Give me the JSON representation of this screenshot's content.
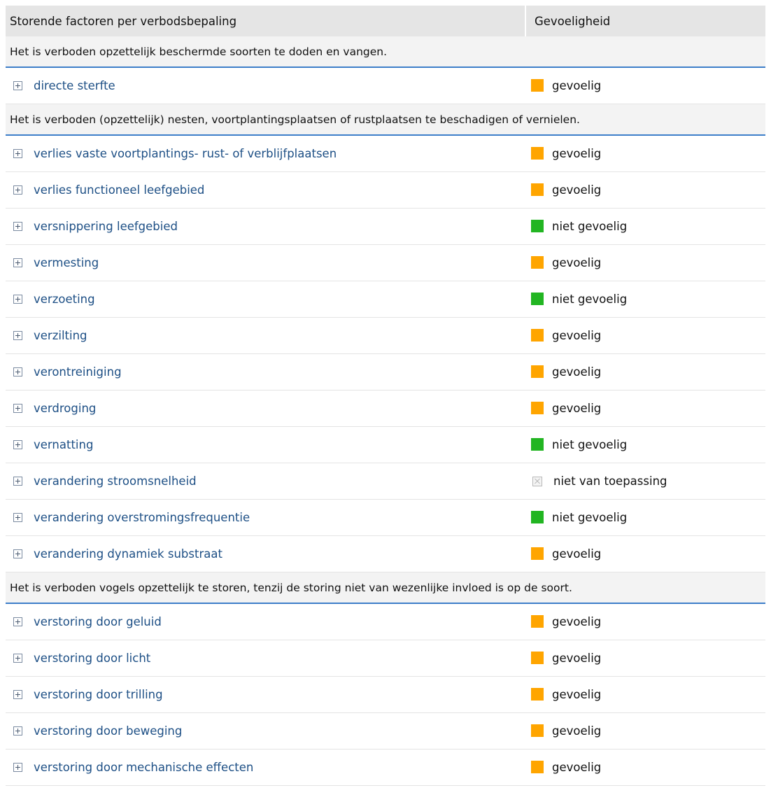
{
  "header": {
    "col_factor": "Storende factoren per verbodsbepaling",
    "col_sensitivity": "Gevoeligheid"
  },
  "legend_colors": {
    "gevoelig": "#ffa500",
    "niet gevoelig": "#22b522",
    "niet van toepassing": "#f4f4f4"
  },
  "groups": [
    {
      "heading": "Het is verboden opzettelijk beschermde soorten te doden en vangen.",
      "rows": [
        {
          "factor": "directe sterfte",
          "status": "gevoelig",
          "icon": "orange-square-icon"
        }
      ]
    },
    {
      "heading": "Het is verboden (opzettelijk) nesten, voortplantingsplaatsen of rustplaatsen te beschadigen of vernielen.",
      "rows": [
        {
          "factor": "verlies vaste voortplantings- rust- of verblijfplaatsen",
          "status": "gevoelig",
          "icon": "orange-square-icon"
        },
        {
          "factor": "verlies functioneel leefgebied",
          "status": "gevoelig",
          "icon": "orange-square-icon"
        },
        {
          "factor": "versnippering leefgebied",
          "status": "niet gevoelig",
          "icon": "green-square-icon"
        },
        {
          "factor": "vermesting",
          "status": "gevoelig",
          "icon": "orange-square-icon"
        },
        {
          "factor": "verzoeting",
          "status": "niet gevoelig",
          "icon": "green-square-icon"
        },
        {
          "factor": "verzilting",
          "status": "gevoelig",
          "icon": "orange-square-icon"
        },
        {
          "factor": "verontreiniging",
          "status": "gevoelig",
          "icon": "orange-square-icon"
        },
        {
          "factor": "verdroging",
          "status": "gevoelig",
          "icon": "orange-square-icon"
        },
        {
          "factor": "vernatting",
          "status": "niet gevoelig",
          "icon": "green-square-icon"
        },
        {
          "factor": "verandering stroomsnelheid",
          "status": "niet van toepassing",
          "icon": "crossed-box-icon"
        },
        {
          "factor": "verandering overstromingsfrequentie",
          "status": "niet gevoelig",
          "icon": "green-square-icon"
        },
        {
          "factor": "verandering dynamiek substraat",
          "status": "gevoelig",
          "icon": "orange-square-icon"
        }
      ]
    },
    {
      "heading": "Het is verboden vogels opzettelijk te storen, tenzij de storing niet van wezenlijke invloed is op de soort.",
      "rows": [
        {
          "factor": "verstoring door geluid",
          "status": "gevoelig",
          "icon": "orange-square-icon"
        },
        {
          "factor": "verstoring door licht",
          "status": "gevoelig",
          "icon": "orange-square-icon"
        },
        {
          "factor": "verstoring door trilling",
          "status": "gevoelig",
          "icon": "orange-square-icon"
        },
        {
          "factor": "verstoring door beweging",
          "status": "gevoelig",
          "icon": "orange-square-icon"
        },
        {
          "factor": "verstoring door mechanische effecten",
          "status": "gevoelig",
          "icon": "orange-square-icon"
        }
      ]
    }
  ]
}
